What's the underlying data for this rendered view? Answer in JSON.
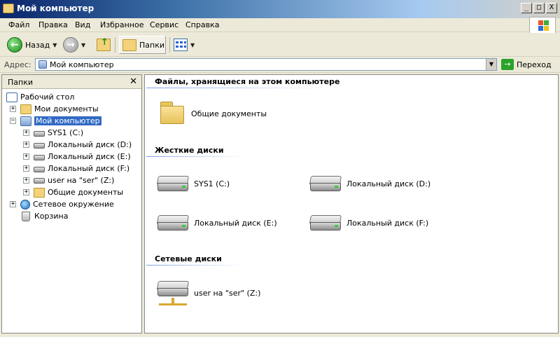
{
  "window": {
    "title": "Мой компьютер",
    "min_label": "_",
    "max_label": "□",
    "close_label": "X"
  },
  "menu": [
    "Файл",
    "Правка",
    "Вид",
    "Избранное",
    "Сервис",
    "Справка"
  ],
  "toolbar": {
    "back_label": "Назад",
    "folders_label": "Папки"
  },
  "address": {
    "label": "Адрес:",
    "value": "Мой компьютер",
    "go_label": "Переход"
  },
  "left_pane": {
    "title": "Папки",
    "close_label": "✕",
    "tree": [
      {
        "label": "Рабочий стол",
        "icon": "desktop-icon"
      },
      {
        "label": "Мои документы",
        "icon": "my-documents-icon",
        "expander": "+"
      },
      {
        "label": "Мой компьютер",
        "icon": "computer-icon",
        "expander": "−",
        "selected": true
      },
      {
        "label": "SYS1 (C:)",
        "icon": "drive-icon",
        "expander": "+"
      },
      {
        "label": "Локальный диск (D:)",
        "icon": "drive-icon",
        "expander": "+"
      },
      {
        "label": "Локальный диск (E:)",
        "icon": "drive-icon",
        "expander": "+"
      },
      {
        "label": "Локальный диск (F:)",
        "icon": "drive-icon",
        "expander": "+"
      },
      {
        "label": "user на \"ser\" (Z:)",
        "icon": "network-drive-icon",
        "expander": "+"
      },
      {
        "label": "Общие документы",
        "icon": "folder-icon",
        "expander": "+"
      },
      {
        "label": "Сетевое окружение",
        "icon": "network-icon",
        "expander": "+"
      },
      {
        "label": "Корзина",
        "icon": "recycle-bin-icon"
      }
    ]
  },
  "right_pane": {
    "sections": [
      {
        "title": "Файлы, хранящиеся на этом компьютере",
        "items": [
          {
            "label": "Общие документы",
            "icon": "folder-icon"
          }
        ]
      },
      {
        "title": "Жесткие диски",
        "items": [
          {
            "label": "SYS1 (C:)",
            "icon": "hard-drive-icon"
          },
          {
            "label": "Локальный диск (D:)",
            "icon": "hard-drive-icon"
          },
          {
            "label": "Локальный диск (E:)",
            "icon": "hard-drive-icon"
          },
          {
            "label": "Локальный диск (F:)",
            "icon": "hard-drive-icon"
          }
        ]
      },
      {
        "title": "Сетевые диски",
        "items": [
          {
            "label": "user на \"ser\" (Z:)",
            "icon": "network-drive-icon"
          }
        ]
      }
    ]
  }
}
